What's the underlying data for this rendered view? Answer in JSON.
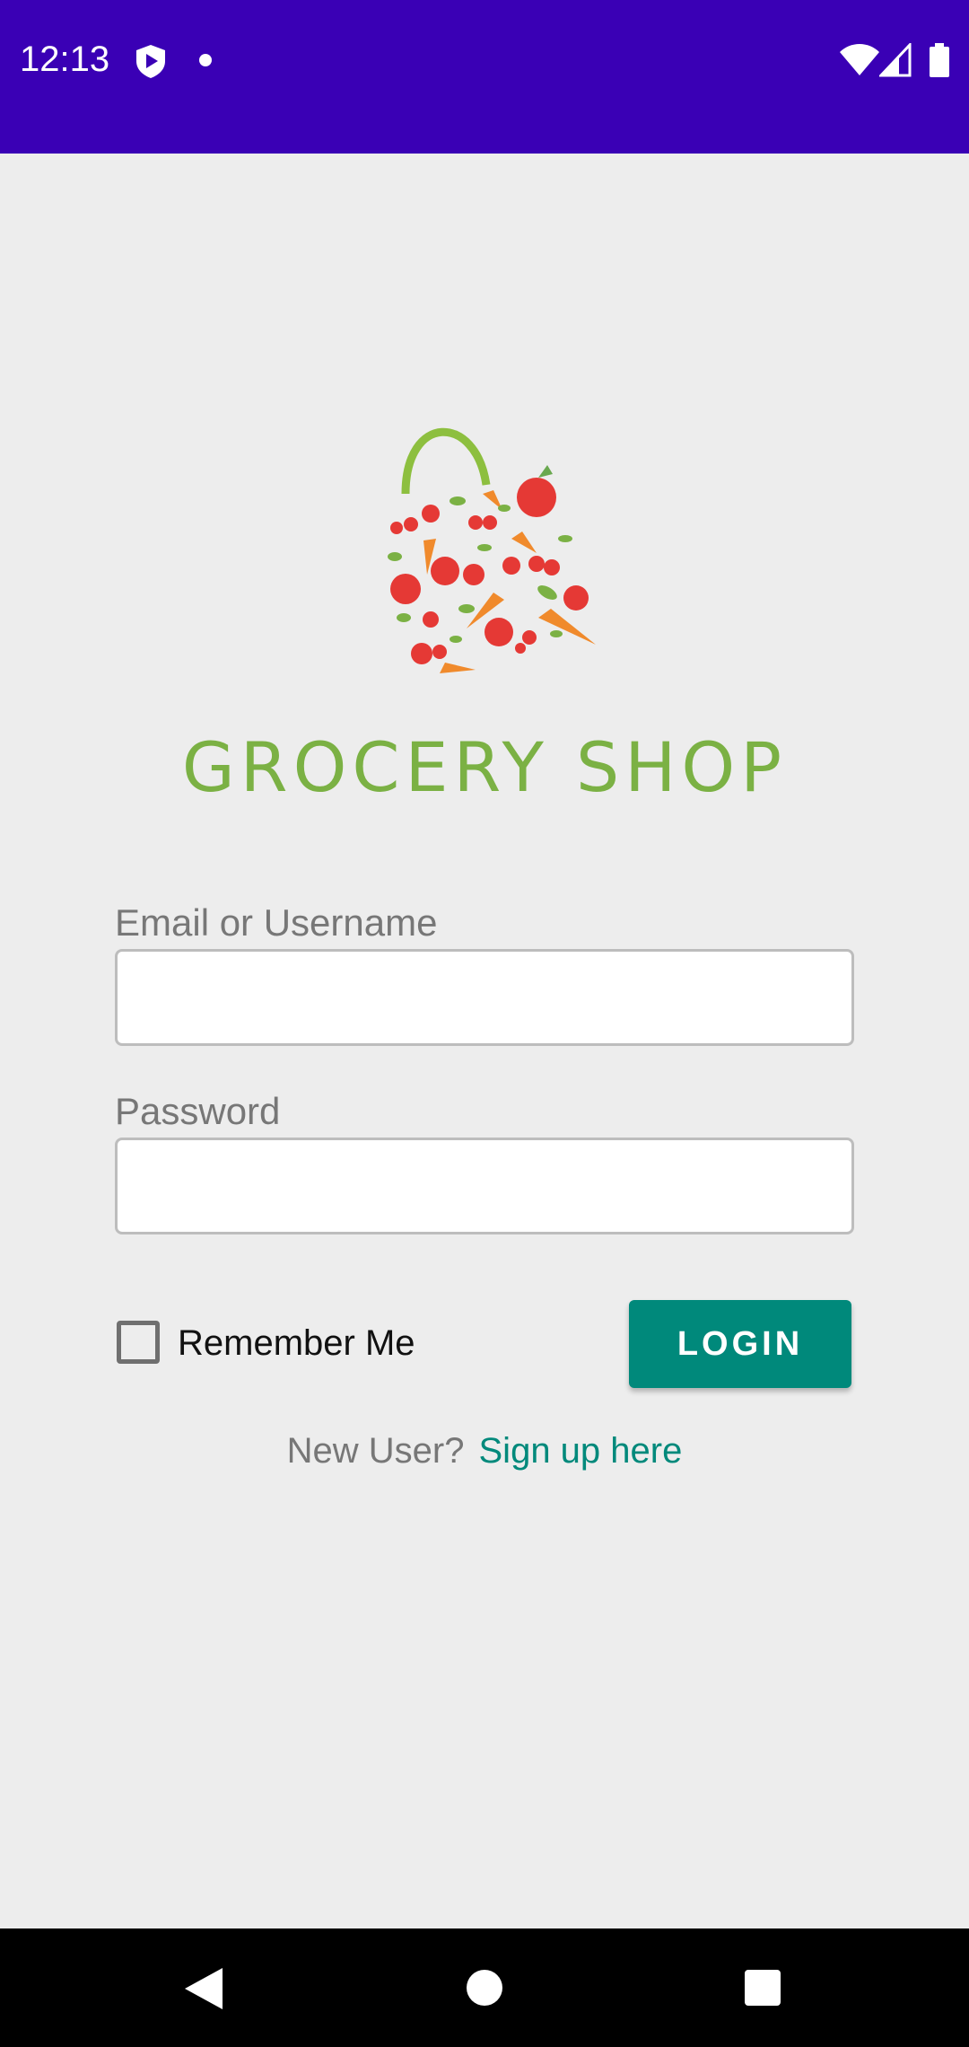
{
  "status_bar": {
    "time": "12:13",
    "icons": [
      "shield-icon",
      "notification-dot-icon",
      "wifi-icon",
      "signal-icon",
      "battery-icon"
    ],
    "background": "#3a00b5"
  },
  "logo": {
    "text": "GROCERY SHOP",
    "icon": "grocery-bag-icon",
    "color": "#7bb144"
  },
  "form": {
    "email_label": "Email or Username",
    "email_value": "",
    "password_label": "Password",
    "password_value": "",
    "remember_label": "Remember Me",
    "remember_checked": false,
    "login_label": "LOGIN",
    "signup_prompt": "New User?",
    "signup_link": "Sign up here",
    "accent": "#00897b"
  },
  "nav_bar": {
    "icons": [
      "back-icon",
      "home-icon",
      "recent-apps-icon"
    ]
  }
}
